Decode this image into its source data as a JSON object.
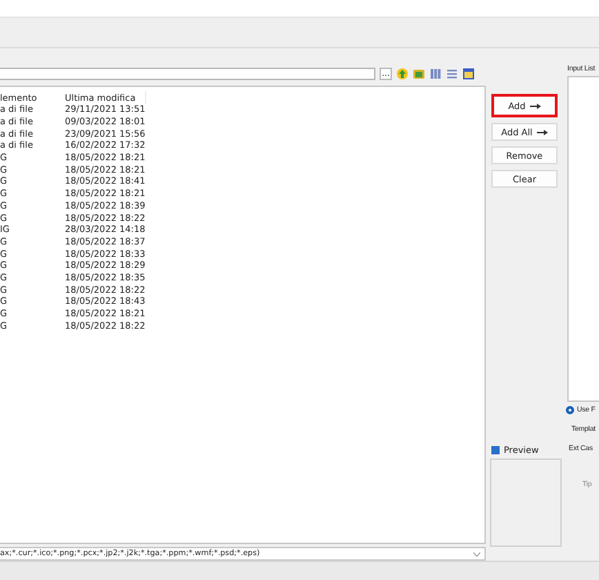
{
  "file_list": {
    "columns": [
      "lemento",
      "Ultima modifica"
    ],
    "rows": [
      [
        "a di file",
        "29/11/2021 13:51"
      ],
      [
        "a di file",
        "09/03/2022 18:01"
      ],
      [
        "a di file",
        "23/09/2021 15:56"
      ],
      [
        "a di file",
        "16/02/2022 17:32"
      ],
      [
        "G",
        "18/05/2022 18:21"
      ],
      [
        "G",
        "18/05/2022 18:21"
      ],
      [
        "G",
        "18/05/2022 18:41"
      ],
      [
        "G",
        "18/05/2022 18:21"
      ],
      [
        "G",
        "18/05/2022 18:39"
      ],
      [
        "G",
        "18/05/2022 18:22"
      ],
      [
        "IG",
        "28/03/2022 14:18"
      ],
      [
        "G",
        "18/05/2022 18:37"
      ],
      [
        "G",
        "18/05/2022 18:33"
      ],
      [
        "G",
        "18/05/2022 18:29"
      ],
      [
        "G",
        "18/05/2022 18:35"
      ],
      [
        "G",
        "18/05/2022 18:22"
      ],
      [
        "G",
        "18/05/2022 18:43"
      ],
      [
        "G",
        "18/05/2022 18:21"
      ],
      [
        "G",
        "18/05/2022 18:22"
      ]
    ]
  },
  "browse_button": "...",
  "filter": "ax;*.cur;*.ico;*.png;*.pcx;*.jp2;*.j2k;*.tga;*.ppm;*.wmf;*.psd;*.eps)",
  "buttons": [
    {
      "label": "Add",
      "highlighted": true
    },
    {
      "label": "Add All",
      "highlighted": false
    },
    {
      "label": "Remove",
      "highlighted": false
    },
    {
      "label": "Clear",
      "highlighted": false
    }
  ],
  "preview": {
    "label": "Preview",
    "checked": true
  },
  "input_list_label": "Input List",
  "use_option": {
    "label": "Use F",
    "selected": true
  },
  "template_label": "Templat",
  "ext_case_label": "Ext Cas",
  "tip_label": "Tip"
}
